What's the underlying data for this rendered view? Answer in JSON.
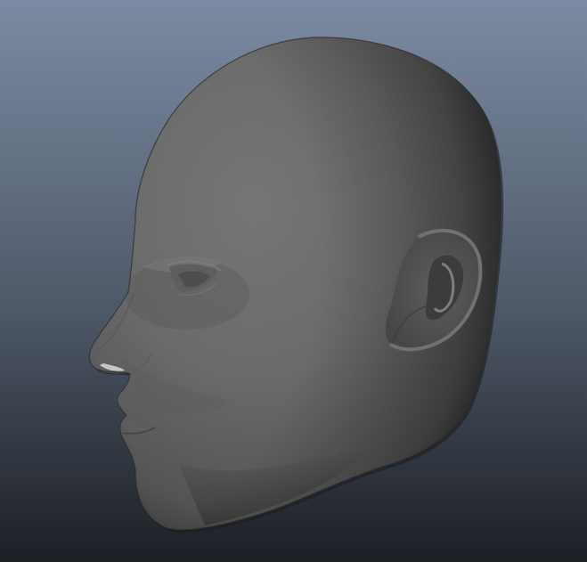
{
  "viewport": {
    "background_top": "#7c8ba3",
    "background_mid": "#4e5868",
    "background_bottom": "#1c1f24",
    "model_base_color": "#6c6c6c",
    "model_shadow_color": "#2f2f30",
    "model_highlight_color": "#7a7a7a"
  },
  "model": {
    "name": "head-mesh"
  }
}
